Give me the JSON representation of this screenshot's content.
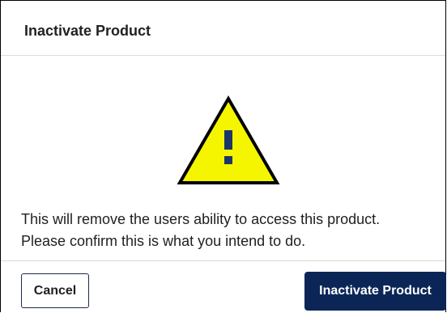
{
  "dialog": {
    "title": "Inactivate Product",
    "warning_icon": "warning-triangle-icon",
    "message_lines": [
      "This will remove the users ability to access this product.",
      "Please confirm this is what you intend to do."
    ],
    "cancel_label": "Cancel",
    "confirm_label": "Inactivate Product"
  },
  "colors": {
    "warning_fill": "#f5f500",
    "warning_stroke": "#000000",
    "exclamation": "#1c3766",
    "primary": "#0b2656",
    "cancel_border": "#1d2a4d"
  }
}
